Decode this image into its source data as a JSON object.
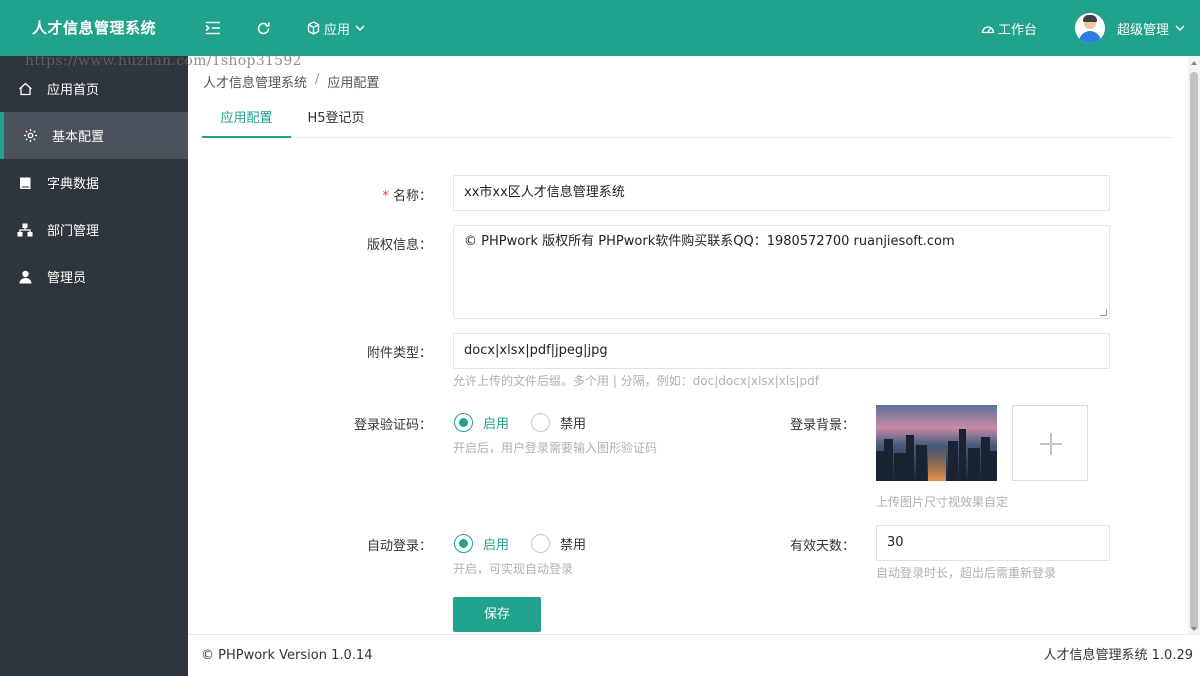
{
  "app": {
    "title": "人才信息管理系统",
    "accent_color": "#20a28c",
    "sidebar_color": "#2f353d"
  },
  "header": {
    "menu_icon": "menu-fold-icon",
    "refresh_icon": "refresh-icon",
    "app_menu": {
      "label": "应用",
      "icon": "cube-icon"
    },
    "workbench": {
      "label": "工作台",
      "icon": "dashboard-icon"
    },
    "user": {
      "label": "超级管理",
      "icon": "avatar"
    }
  },
  "watermark": "https://www.huzhan.com/1shop31592",
  "sidebar": {
    "items": [
      {
        "label": "应用首页",
        "icon": "home-icon",
        "active": false
      },
      {
        "label": "基本配置",
        "icon": "gear-icon",
        "active": true
      },
      {
        "label": "字典数据",
        "icon": "book-icon",
        "active": false
      },
      {
        "label": "部门管理",
        "icon": "org-tree-icon",
        "active": false
      },
      {
        "label": "管理员",
        "icon": "user-icon",
        "active": false
      }
    ]
  },
  "breadcrumb": [
    "人才信息管理系统",
    "应用配置"
  ],
  "breadcrumb_sep": "/",
  "tabs": [
    {
      "label": "应用配置",
      "active": true
    },
    {
      "label": "H5登记页",
      "active": false
    }
  ],
  "form": {
    "required_mark": "*",
    "name": {
      "label": "名称：",
      "value": "xx市xx区人才信息管理系统"
    },
    "copyright": {
      "label": "版权信息：",
      "value": "© PHPwork 版权所有 PHPwork软件购买联系QQ：1980572700 ruanjiesoft.com"
    },
    "attachment": {
      "label": "附件类型：",
      "value": "docx|xlsx|pdf|jpeg|jpg",
      "help": "允许上传的文件后缀。多个用 | 分隔，例如：doc|docx|xlsx|xls|pdf"
    },
    "captcha": {
      "label": "登录验证码：",
      "option_on": "启用",
      "option_off": "禁用",
      "selected": "启用",
      "help": "开启后，用户登录需要输入图形验证码"
    },
    "login_bg": {
      "label": "登录背景：",
      "help": "上传图片尺寸视效果自定",
      "upload_icon": "plus-icon"
    },
    "auto_login": {
      "label": "自动登录：",
      "option_on": "启用",
      "option_off": "禁用",
      "selected": "启用",
      "help": "开启，可实现自动登录"
    },
    "valid_days": {
      "label": "有效天数：",
      "value": "30",
      "help": "自动登录时长，超出后需重新登录"
    },
    "save_label": "保存"
  },
  "footer": {
    "left": "© PHPwork Version 1.0.14",
    "right": "人才信息管理系统 1.0.29"
  }
}
